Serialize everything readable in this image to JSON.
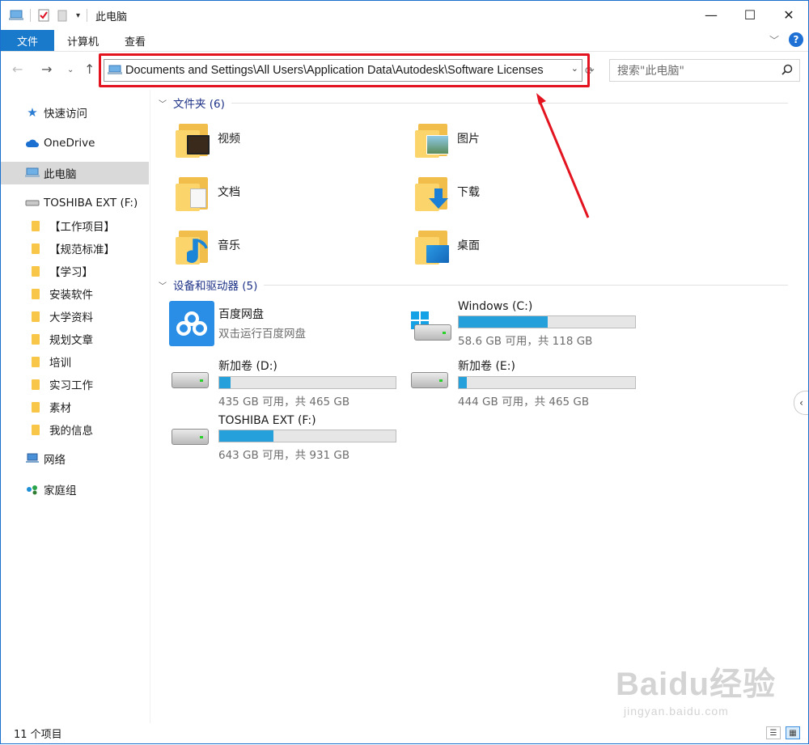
{
  "window": {
    "title": "此电脑"
  },
  "ribbon": {
    "tabs": [
      "文件",
      "计算机",
      "查看"
    ]
  },
  "address": {
    "path": "Documents and Settings\\All Users\\Application Data\\Autodesk\\Software Licenses",
    "search_placeholder": "搜索\"此电脑\""
  },
  "sidebar": {
    "quick_access": "快速访问",
    "onedrive": "OneDrive",
    "this_pc": "此电脑",
    "drive_f": "TOSHIBA EXT (F:)",
    "folders": [
      "【工作项目】",
      "【规范标准】",
      "【学习】",
      "安装软件",
      "大学资料",
      "规划文章",
      "培训",
      "实习工作",
      "素材",
      "我的信息"
    ],
    "network": "网络",
    "homegroup": "家庭组"
  },
  "content": {
    "folders_header": "文件夹 (6)",
    "folders": [
      {
        "name": "视频",
        "icon": "video-folder-icon"
      },
      {
        "name": "图片",
        "icon": "pictures-folder-icon"
      },
      {
        "name": "文档",
        "icon": "documents-folder-icon"
      },
      {
        "name": "下载",
        "icon": "downloads-folder-icon"
      },
      {
        "name": "音乐",
        "icon": "music-folder-icon"
      },
      {
        "name": "桌面",
        "icon": "desktop-folder-icon"
      }
    ],
    "devices_header": "设备和驱动器 (5)",
    "baidu": {
      "name": "百度网盘",
      "desc": "双击运行百度网盘"
    },
    "drives": [
      {
        "name": "Windows (C:)",
        "free": "58.6 GB 可用，共 118 GB",
        "used_fraction": 0.503
      },
      {
        "name": "新加卷 (D:)",
        "free": "435 GB 可用，共 465 GB",
        "used_fraction": 0.065
      },
      {
        "name": "新加卷 (E:)",
        "free": "444 GB 可用，共 465 GB",
        "used_fraction": 0.045
      },
      {
        "name": "TOSHIBA EXT (F:)",
        "free": "643 GB 可用，共 931 GB",
        "used_fraction": 0.309
      }
    ]
  },
  "status": {
    "items": "11 个项目"
  },
  "watermark": {
    "brand": "Baidu经验",
    "url": "jingyan.baidu.com"
  },
  "colors": {
    "accent": "#1979ca",
    "highlight": "#e3141f",
    "bar_fill": "#26a0da"
  }
}
